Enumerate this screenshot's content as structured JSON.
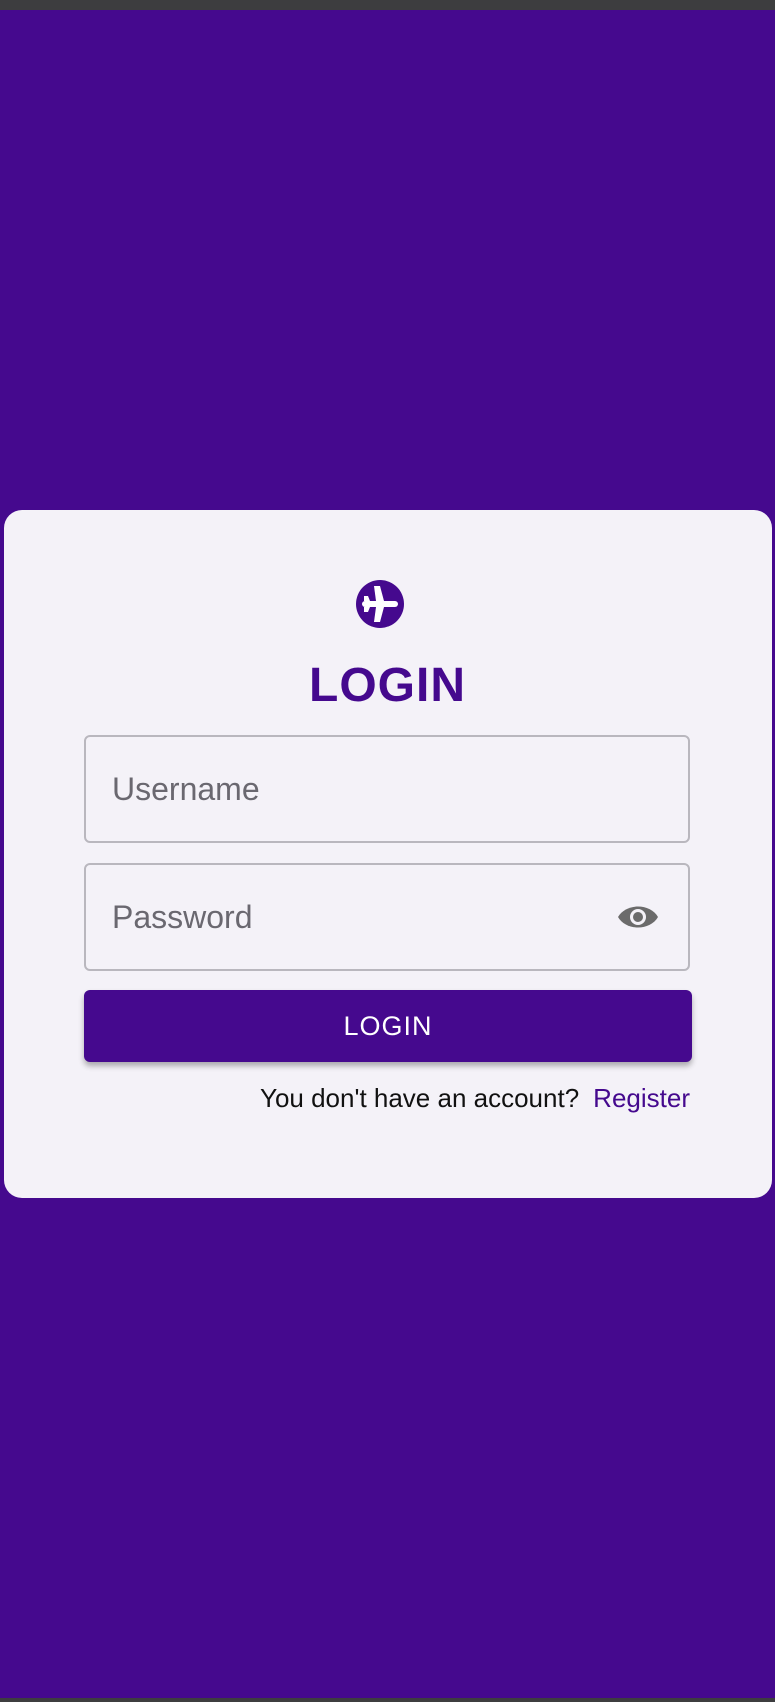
{
  "login": {
    "title": "LOGIN",
    "username_placeholder": "Username",
    "password_placeholder": "Password",
    "submit_label": "LOGIN",
    "register_prompt": "You don't have an account?",
    "register_link": "Register"
  },
  "icons": {
    "logo": "airplane-icon",
    "password_toggle": "eye-icon"
  },
  "colors": {
    "brand": "#45098e",
    "card_background": "#f4f2f8",
    "field_border": "#b9b7be",
    "button_text": "#ffffff"
  }
}
